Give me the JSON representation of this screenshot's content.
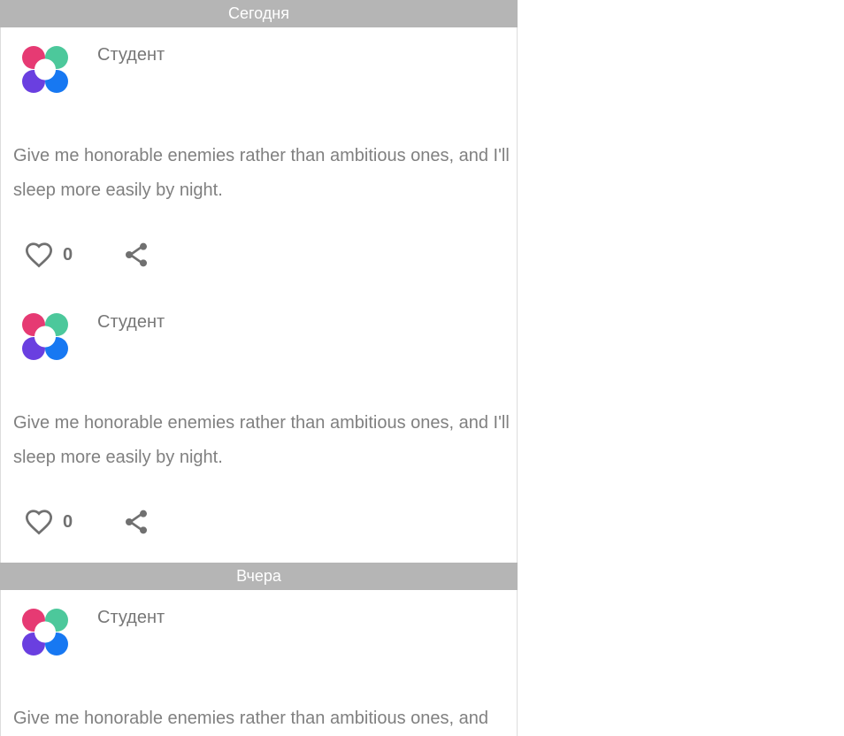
{
  "colors": {
    "header_bg": "#b5b5b5",
    "header_text": "#ffffff",
    "logo_pink": "#e63a73",
    "logo_green": "#4cc89b",
    "logo_purple": "#6a3fe0",
    "logo_blue": "#1778f2",
    "icon_gray": "#707070"
  },
  "sections": [
    {
      "label": "Сегодня",
      "posts": [
        {
          "author": "Студент",
          "text": "Give me honorable enemies rather than ambitious ones, and I'll sleep more easily by night.",
          "likes": "0",
          "like_icon": "heart-outline-icon",
          "share_icon": "share-icon"
        },
        {
          "author": "Студент",
          "text": "Give me honorable enemies rather than ambitious ones, and I'll sleep more easily by night.",
          "likes": "0",
          "like_icon": "heart-outline-icon",
          "share_icon": "share-icon"
        }
      ]
    },
    {
      "label": "Вчера",
      "posts": [
        {
          "author": "Студент",
          "text": "Give me honorable enemies rather than ambitious ones, and"
        }
      ]
    }
  ]
}
